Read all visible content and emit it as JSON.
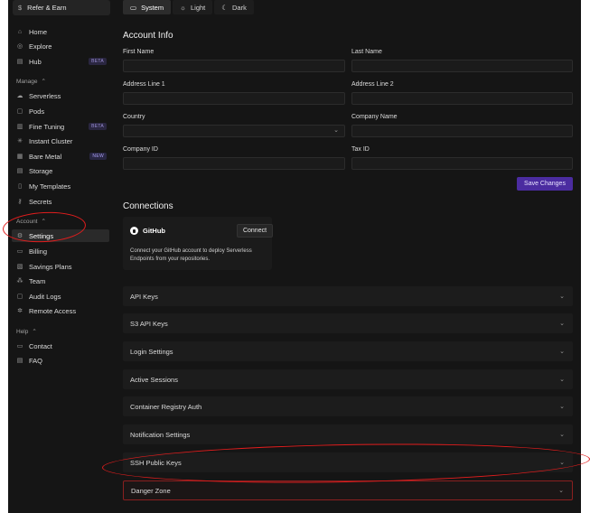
{
  "sidebar": {
    "refer": {
      "icon": "dollar-icon",
      "label": "Refer & Earn"
    },
    "top_items": [
      {
        "label": "Home",
        "icon": "home-icon"
      },
      {
        "label": "Explore",
        "icon": "compass-icon"
      },
      {
        "label": "Hub",
        "icon": "hub-icon",
        "badge": "BETA"
      }
    ],
    "manage_label": "Manage",
    "manage_items": [
      {
        "label": "Serverless",
        "icon": "cloud-icon"
      },
      {
        "label": "Pods",
        "icon": "pod-icon"
      },
      {
        "label": "Fine Tuning",
        "icon": "tuning-icon",
        "badge": "BETA"
      },
      {
        "label": "Instant Cluster",
        "icon": "cluster-icon"
      },
      {
        "label": "Bare Metal",
        "icon": "server-icon",
        "badge": "NEW"
      },
      {
        "label": "Storage",
        "icon": "storage-icon"
      },
      {
        "label": "My Templates",
        "icon": "template-icon"
      },
      {
        "label": "Secrets",
        "icon": "key-icon"
      }
    ],
    "account_label": "Account",
    "account_items": [
      {
        "label": "Settings",
        "icon": "gear-icon",
        "active": true
      },
      {
        "label": "Billing",
        "icon": "billing-icon"
      },
      {
        "label": "Savings Plans",
        "icon": "savings-icon"
      },
      {
        "label": "Team",
        "icon": "team-icon"
      },
      {
        "label": "Audit Logs",
        "icon": "log-icon"
      },
      {
        "label": "Remote Access",
        "icon": "remote-icon"
      }
    ],
    "help_label": "Help",
    "help_items": [
      {
        "label": "Contact",
        "icon": "chat-icon"
      },
      {
        "label": "FAQ",
        "icon": "book-icon"
      }
    ]
  },
  "theme": {
    "tabs": [
      {
        "label": "System",
        "icon": "monitor-icon",
        "selected": true
      },
      {
        "label": "Light",
        "icon": "sun-icon"
      },
      {
        "label": "Dark",
        "icon": "moon-icon"
      }
    ]
  },
  "account_info": {
    "title": "Account Info",
    "fields": {
      "first_name": {
        "label": "First Name",
        "value": ""
      },
      "last_name": {
        "label": "Last Name",
        "value": ""
      },
      "address1": {
        "label": "Address Line 1",
        "value": ""
      },
      "address2": {
        "label": "Address Line 2",
        "value": ""
      },
      "country": {
        "label": "Country",
        "value": ""
      },
      "company_name": {
        "label": "Company Name",
        "value": ""
      },
      "company_id": {
        "label": "Company ID",
        "value": ""
      },
      "tax_id": {
        "label": "Tax ID",
        "value": ""
      }
    },
    "save_label": "Save Changes"
  },
  "connections": {
    "title": "Connections",
    "github": {
      "name": "GitHub",
      "connect_label": "Connect",
      "description": "Connect your GitHub account to deploy Serverless Endpoints from your repositories."
    }
  },
  "sections": [
    "API Keys",
    "S3 API Keys",
    "Login Settings",
    "Active Sessions",
    "Container Registry Auth",
    "Notification Settings",
    "SSH Public Keys",
    "Danger Zone"
  ],
  "colors": {
    "background": "#151515",
    "accent": "#4b2ca0",
    "danger_border": "#8a1f1f",
    "annotation": "#e21d1d"
  }
}
